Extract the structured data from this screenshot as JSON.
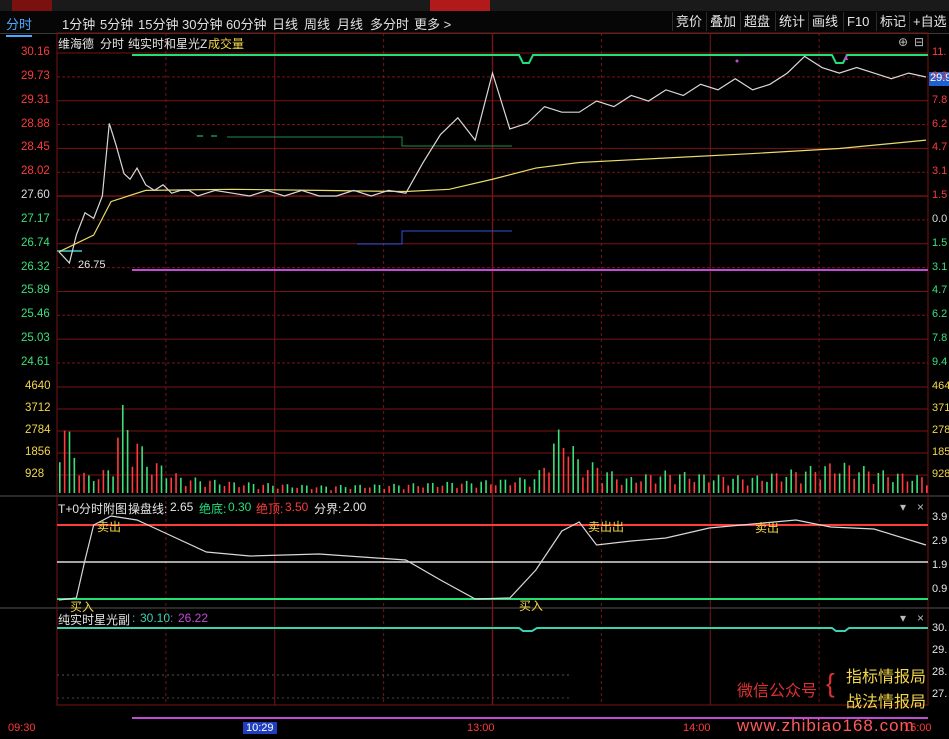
{
  "colors": {
    "bg": "#000000",
    "grid": "#7a1414",
    "price": "#d8d8d8",
    "avg": "#e8dc6a",
    "green": "#21e07a",
    "purple": "#c24ad4",
    "blue": "#2f4fd8",
    "teal": "#3ad1b0",
    "up": "#ff3b3b",
    "down": "#3be07a",
    "yellow": "#f3d74a"
  },
  "tabs": [
    "分时",
    "1分钟",
    "5分钟",
    "15分钟",
    "30分钟",
    "60分钟",
    "日线",
    "周线",
    "月线",
    "多分时",
    "更多 >"
  ],
  "right_buttons": [
    "竞价",
    "叠加",
    "超盘",
    "统计",
    "画线",
    "F10",
    "标记",
    "+自选"
  ],
  "header": {
    "stock": "维海德",
    "mode": "分时",
    "indicator": "纯实时和星光Z",
    "vol_label": "成交量"
  },
  "price_axis": {
    "left_labels": [
      "30.16",
      "29.73",
      "29.31",
      "28.88",
      "28.45",
      "28.02",
      "27.60",
      "27.17",
      "26.74",
      "26.32",
      "25.89",
      "25.46",
      "25.03",
      "24.61"
    ],
    "right_labels": [
      "11.",
      "9.3",
      "7.8",
      "6.2",
      "4.7",
      "3.1",
      "1.5",
      "0.0",
      "1.5",
      "3.1",
      "4.7",
      "6.2",
      "7.8",
      "9.4"
    ],
    "current_price_tag": "29.9",
    "low_marker": "26.75",
    "min": 24.61,
    "max": 30.16
  },
  "volume_axis": {
    "left_labels": [
      "4640",
      "3712",
      "2784",
      "1856",
      "928"
    ],
    "right_labels": [
      "464",
      "371",
      "278",
      "185",
      "928"
    ]
  },
  "sub1": {
    "title": "T+0分时附图",
    "op_label": "操盘线:",
    "op_value": "2.65",
    "abs_low_label": "绝底:",
    "abs_low_value": "0.30",
    "abs_top_label": "绝顶:",
    "abs_top_value": "3.50",
    "bound_label": "分界:",
    "bound_value": "2.00",
    "right_labels": [
      "3.9",
      "2.9",
      "1.9",
      "0.9"
    ],
    "signals": {
      "sell": "卖出",
      "buy": "买入",
      "buysell": "卖出出"
    }
  },
  "sub2": {
    "title": "纯实时星光副",
    "v1": "30.10",
    "v2": "26.22",
    "right_labels": [
      "30.",
      "29.",
      "28.",
      "27."
    ]
  },
  "time_axis": [
    "09:30",
    "10:29",
    "13:00",
    "14:00",
    "15:00"
  ],
  "watermark": {
    "left": "微信公众号",
    "line1": "指标情报局",
    "line2": "战法情报局",
    "url": "www.zhibiao168.com"
  },
  "chart_data": {
    "type": "line",
    "title": "维海德 分时",
    "price_series": {
      "x_fraction": [
        0,
        0.012,
        0.02,
        0.03,
        0.04,
        0.05,
        0.058,
        0.066,
        0.075,
        0.082,
        0.09,
        0.1,
        0.11,
        0.12,
        0.13,
        0.14,
        0.15,
        0.16,
        0.17,
        0.18,
        0.2,
        0.22,
        0.24,
        0.26,
        0.28,
        0.3,
        0.32,
        0.34,
        0.36,
        0.38,
        0.4,
        0.42,
        0.44,
        0.46,
        0.48,
        0.5,
        0.52,
        0.54,
        0.56,
        0.58,
        0.6,
        0.62,
        0.64,
        0.66,
        0.68,
        0.7,
        0.72,
        0.74,
        0.76,
        0.78,
        0.8,
        0.82,
        0.84,
        0.86,
        0.88,
        0.9,
        0.92,
        0.94,
        0.96,
        0.98,
        1.0
      ],
      "values": [
        26.6,
        26.4,
        26.9,
        27.3,
        27.2,
        27.6,
        28.9,
        28.5,
        28.0,
        27.9,
        28.1,
        27.8,
        27.7,
        27.8,
        27.65,
        27.7,
        27.7,
        27.6,
        27.65,
        27.7,
        27.65,
        27.6,
        27.7,
        27.6,
        27.7,
        27.6,
        27.6,
        27.7,
        27.6,
        27.7,
        27.65,
        28.2,
        28.7,
        29.0,
        28.6,
        29.8,
        28.8,
        28.9,
        29.2,
        29.1,
        29.1,
        29.3,
        29.2,
        29.4,
        29.3,
        29.5,
        29.4,
        29.6,
        29.5,
        29.7,
        29.5,
        29.6,
        29.8,
        30.1,
        29.9,
        29.8,
        29.9,
        29.8,
        29.7,
        29.8,
        29.73
      ]
    },
    "avg_series": {
      "x_fraction": [
        0,
        0.04,
        0.06,
        0.1,
        0.2,
        0.3,
        0.4,
        0.45,
        0.5,
        0.55,
        0.6,
        0.7,
        0.8,
        0.9,
        1.0
      ],
      "values": [
        26.6,
        26.9,
        27.5,
        27.7,
        27.72,
        27.7,
        27.68,
        27.72,
        27.9,
        28.1,
        28.2,
        28.28,
        28.36,
        28.45,
        28.6
      ]
    },
    "volume": {
      "x_fraction": [
        0.0,
        0.03,
        0.06,
        0.07,
        0.1,
        0.14,
        0.2,
        0.3,
        0.4,
        0.5,
        0.55,
        0.58,
        0.6,
        0.62,
        0.65,
        0.7,
        0.75,
        0.8,
        0.85,
        0.9,
        0.95,
        1.0
      ],
      "values": [
        4640,
        900,
        1400,
        4900,
        2000,
        900,
        600,
        400,
        500,
        700,
        900,
        3900,
        1700,
        1600,
        800,
        1200,
        1000,
        900,
        1300,
        1700,
        1200,
        900
      ]
    }
  }
}
